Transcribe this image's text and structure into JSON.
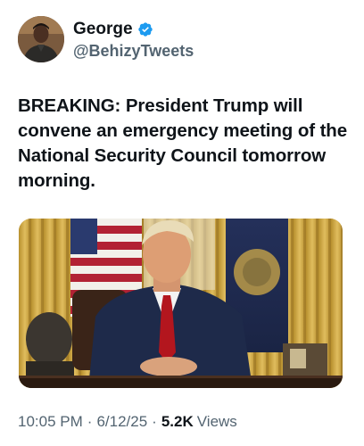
{
  "author": {
    "display_name": "George",
    "handle": "@BehizyTweets",
    "verified": true,
    "verified_icon": "verified-badge-icon",
    "verified_color": "#1d9bf0"
  },
  "tweet": {
    "text": "BREAKING: President Trump will convene an emergency meeting of the National Security Council tomorrow morning."
  },
  "media": {
    "type": "photo"
  },
  "meta": {
    "time": "10:05 PM",
    "separator": "·",
    "date": "6/12/25",
    "views_count": "5.2K",
    "views_label": "Views"
  },
  "colors": {
    "text_primary": "#0f1419",
    "text_secondary": "#536471",
    "accent": "#1d9bf0"
  }
}
